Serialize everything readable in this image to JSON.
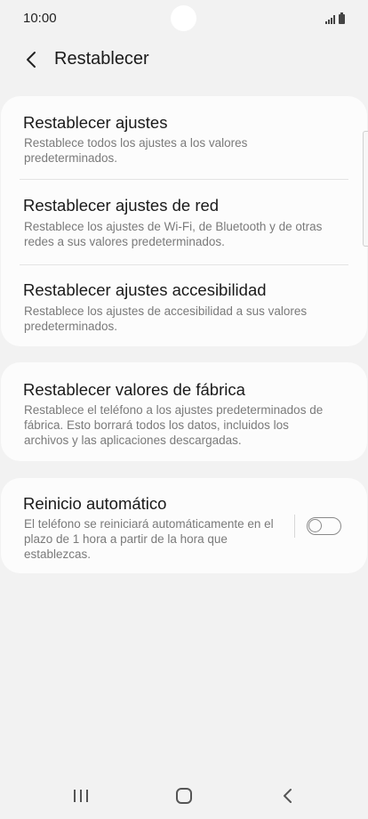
{
  "status_bar": {
    "time": "10:00",
    "icons": [
      "signal-icon",
      "battery-icon"
    ]
  },
  "header": {
    "back_icon": "chevron-left-icon",
    "title": "Restablecer"
  },
  "reset_group": [
    {
      "title": "Restablecer ajustes",
      "description": "Restablece todos los ajustes a los valores predeterminados."
    },
    {
      "title": "Restablecer ajustes de red",
      "description": "Restablece los ajustes de Wi-Fi, de Bluetooth y de otras redes a sus valores predeterminados."
    },
    {
      "title": "Restablecer ajustes accesibilidad",
      "description": "Restablece los ajustes de accesibilidad a sus valores predeterminados."
    }
  ],
  "factory_reset": {
    "title": "Restablecer valores de fábrica",
    "description": "Restablece el teléfono a los ajustes predeterminados de fábrica. Esto borrará todos los datos, incluidos los archivos y las aplicaciones descargadas."
  },
  "auto_restart": {
    "title": "Reinicio automático",
    "description": "El teléfono se reiniciará automáticamente en el plazo de 1 hora a partir de la hora que establezcas.",
    "enabled": false
  },
  "nav_bar": {
    "icons": [
      "recent-apps-icon",
      "home-icon",
      "back-icon"
    ]
  },
  "colors": {
    "background": "#f2f2f2",
    "card": "#fcfcfc",
    "title_text": "#1a1a1a",
    "secondary_text": "#7a7a7a"
  }
}
